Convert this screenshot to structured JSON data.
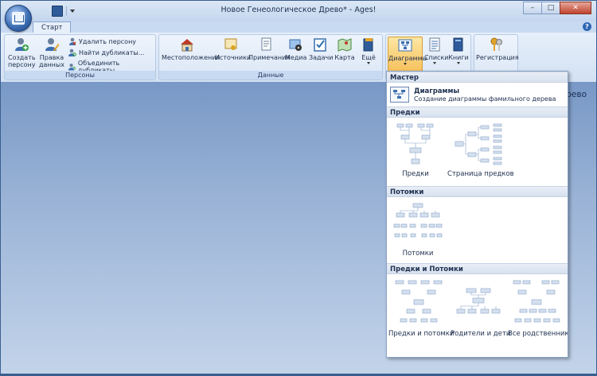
{
  "window": {
    "title": "Новое Генеологическое Древо* - Ages!"
  },
  "tabs": [
    {
      "label": "Старт"
    }
  ],
  "ribbon": {
    "groups": {
      "person": {
        "label": "Персоны",
        "create": "Создать персону",
        "create_l1": "Создать",
        "create_l2": "персону",
        "edit_l1": "Правка",
        "edit_l2": "данных",
        "delete": "Удалить персону",
        "find_duplicates": "Найти дубликаты...",
        "merge_duplicates": "Объединить дубликаты..."
      },
      "data": {
        "label": "Данные",
        "locations": "Местоположения",
        "sources": "Источники",
        "notes": "Примечания",
        "media": "Медиа",
        "tasks": "Задачи",
        "map": "Карта",
        "more": "Ещё"
      },
      "output": {
        "diagrams": "Диаграммы",
        "lists": "Списки",
        "books": "Книги"
      },
      "registration": {
        "label": "Регистрация"
      }
    }
  },
  "workspace": {
    "partial_text": "Древо"
  },
  "menu": {
    "master_header": "Мастер",
    "master_item_title": "Диаграммы",
    "master_item_desc": "Создание диаграммы фамильного дерева",
    "ancestors_header": "Предки",
    "ancestors_items": [
      "Предки",
      "Страница предков"
    ],
    "descendants_header": "Потомки",
    "descendants_items": [
      "Потомки"
    ],
    "both_header": "Предки и Потомки",
    "both_items": [
      "Предки и потомки",
      "Родители и дети",
      "Все родственники"
    ]
  },
  "colors": {
    "accent": "#f7c05b",
    "ribbon_bg": "#dbe7f6",
    "workspace": "#8aa8cf"
  }
}
